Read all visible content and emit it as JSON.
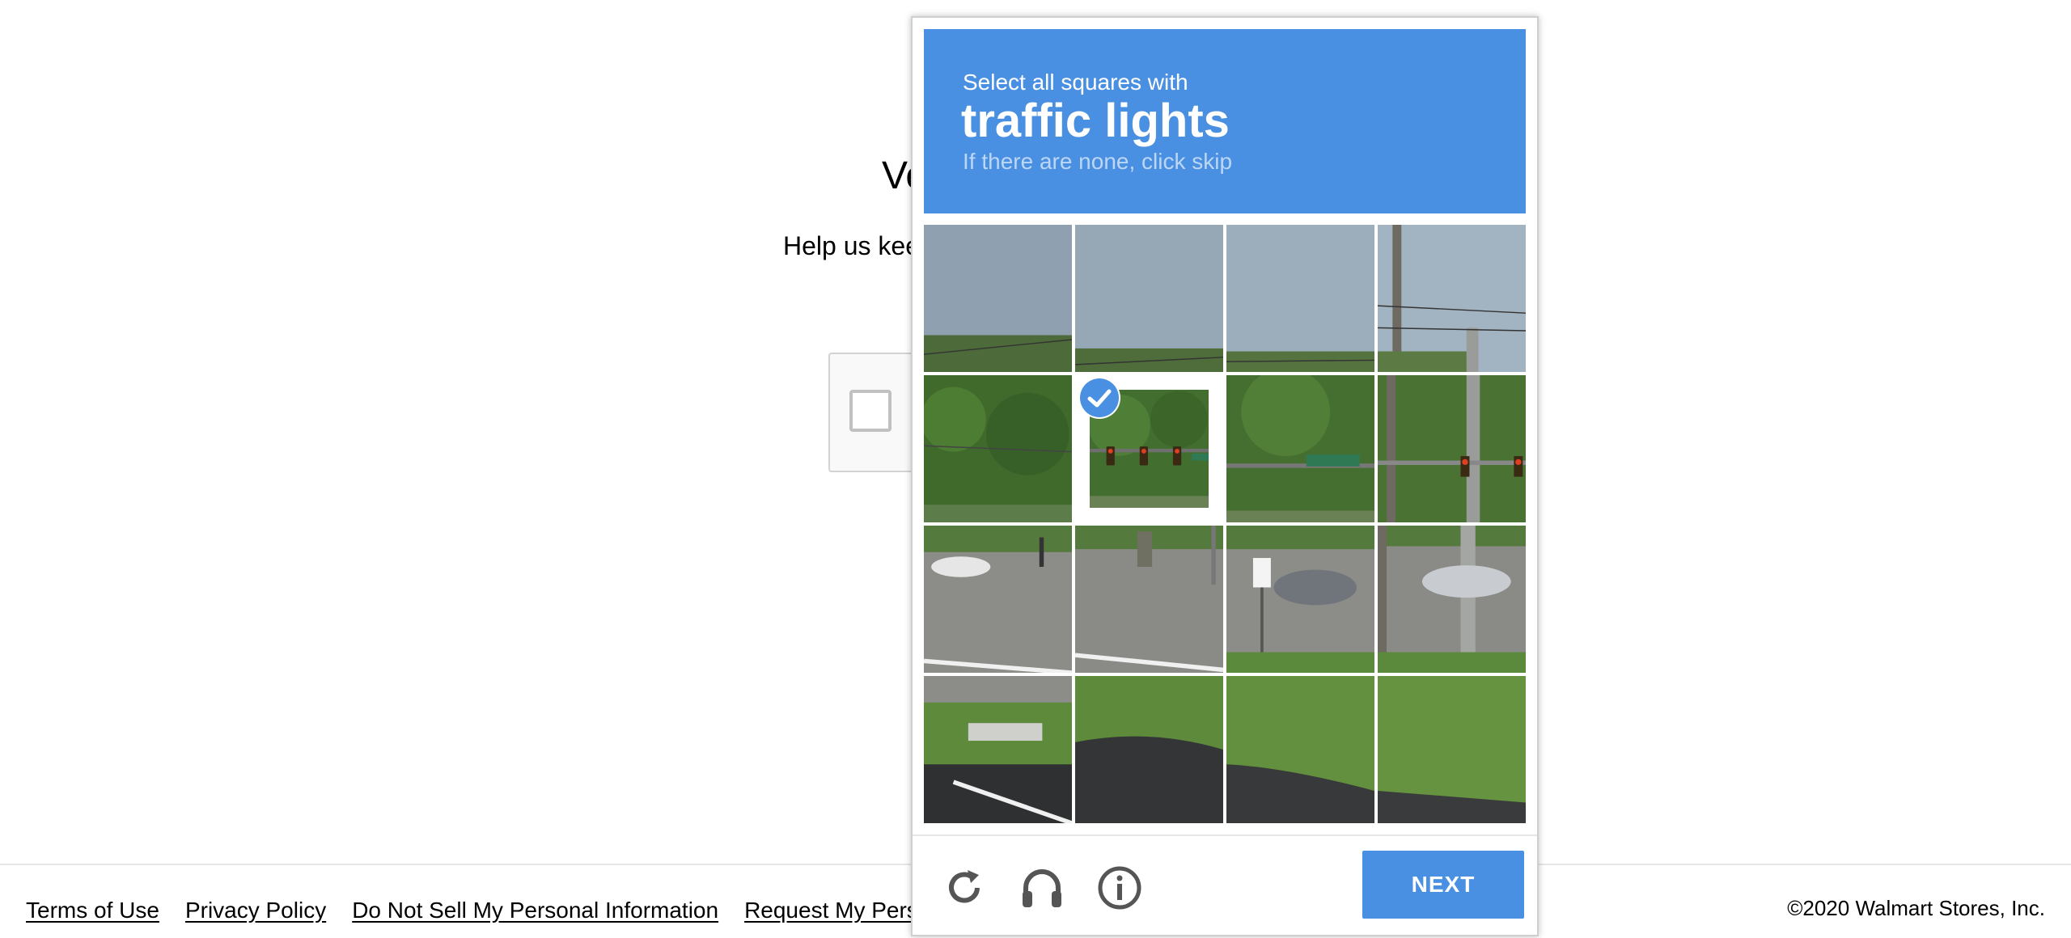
{
  "background": {
    "title": "Ve",
    "subtitle": "Help us kee"
  },
  "challenge": {
    "instruction_line1": "Select all squares with",
    "target": "traffic lights",
    "instruction_line3": "If there are none, click skip",
    "grid": {
      "rows": 4,
      "cols": 4,
      "selected_tiles": [
        [
          1,
          1
        ]
      ]
    },
    "controls": {
      "reload_icon": "reload-icon",
      "audio_icon": "headphones-icon",
      "info_icon": "info-icon",
      "next_label": "NEXT"
    },
    "colors": {
      "accent": "#4a90e2"
    }
  },
  "footer": {
    "links": [
      "Terms of Use",
      "Privacy Policy",
      "Do Not Sell My Personal Information",
      "Request My Perso"
    ],
    "copyright": "©2020 Walmart Stores, Inc."
  }
}
